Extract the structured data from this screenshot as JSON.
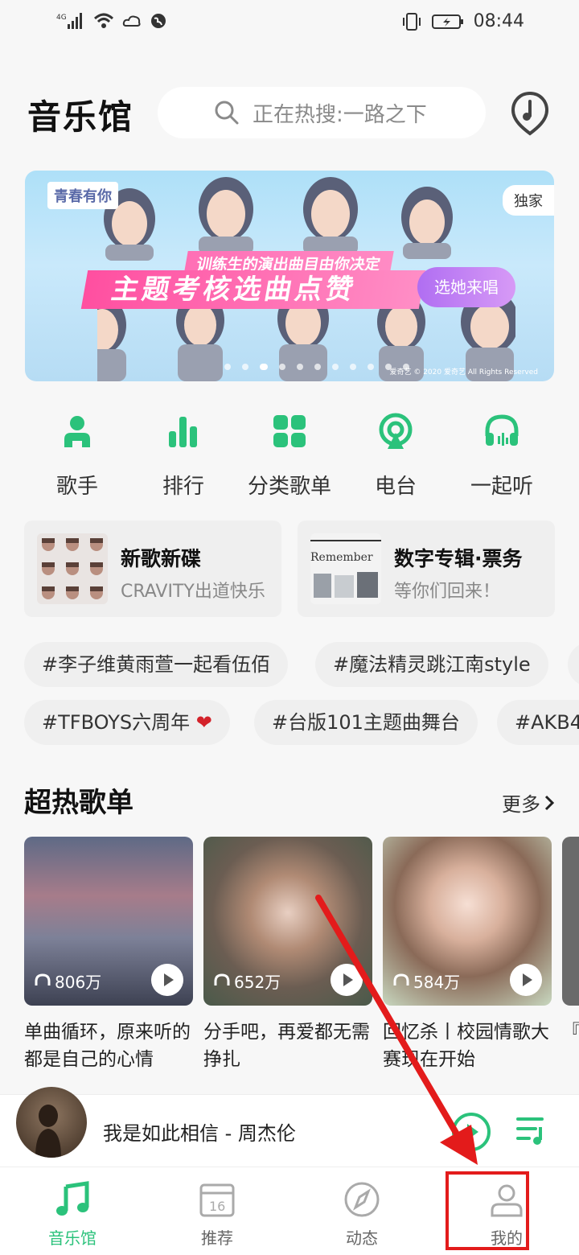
{
  "status": {
    "network": "4G",
    "time": "08:44"
  },
  "header": {
    "title": "音乐馆",
    "search_placeholder": "正在热搜:一路之下"
  },
  "banner": {
    "logo": "青春有你",
    "tag": "独家",
    "subtitle": "训练生的演出曲目由你决定",
    "slogan": "主题考核选曲点赞",
    "cta": "选她来唱",
    "copyright": "爱奇艺 © 2020 爱奇艺 All Rights Reserved",
    "dot_count": 11,
    "active_dot": 2
  },
  "quicknav": [
    {
      "label": "歌手",
      "icon": "singer-icon"
    },
    {
      "label": "排行",
      "icon": "chart-icon"
    },
    {
      "label": "分类歌单",
      "icon": "grid-icon"
    },
    {
      "label": "电台",
      "icon": "radio-icon"
    },
    {
      "label": "一起听",
      "icon": "headphones-icon"
    }
  ],
  "cards": [
    {
      "title": "新歌新碟",
      "subtitle": "CRAVITY出道快乐"
    },
    {
      "title": "数字专辑·票务",
      "subtitle": "等你们回来！",
      "thumb_text": "Remember"
    }
  ],
  "chips_row1": [
    "#李子维黄雨萱一起看伍佰",
    "#魔法精灵跳江南style"
  ],
  "chips_row2": [
    "#TFBOYS六周年",
    "#台版101主题曲舞台",
    "#AKB4"
  ],
  "section": {
    "title": "超热歌单",
    "more": "更多"
  },
  "playlists": [
    {
      "count": "806万",
      "name": "单曲循环，原来听的都是自己的心情"
    },
    {
      "count": "652万",
      "name": "分手吧，再爱都无需挣扎"
    },
    {
      "count": "584万",
      "name": "回忆杀丨校园情歌大赛现在开始"
    },
    {
      "count": "",
      "name": "『PO"
    }
  ],
  "player": {
    "song": "我是如此相信 - 周杰伦"
  },
  "tabs": [
    {
      "label": "音乐馆",
      "active": true
    },
    {
      "label": "推荐",
      "active": false,
      "date": "16"
    },
    {
      "label": "动态",
      "active": false
    },
    {
      "label": "我的",
      "active": false
    }
  ],
  "colors": {
    "accent": "#2bc27b",
    "annotation": "#e31b1b"
  }
}
